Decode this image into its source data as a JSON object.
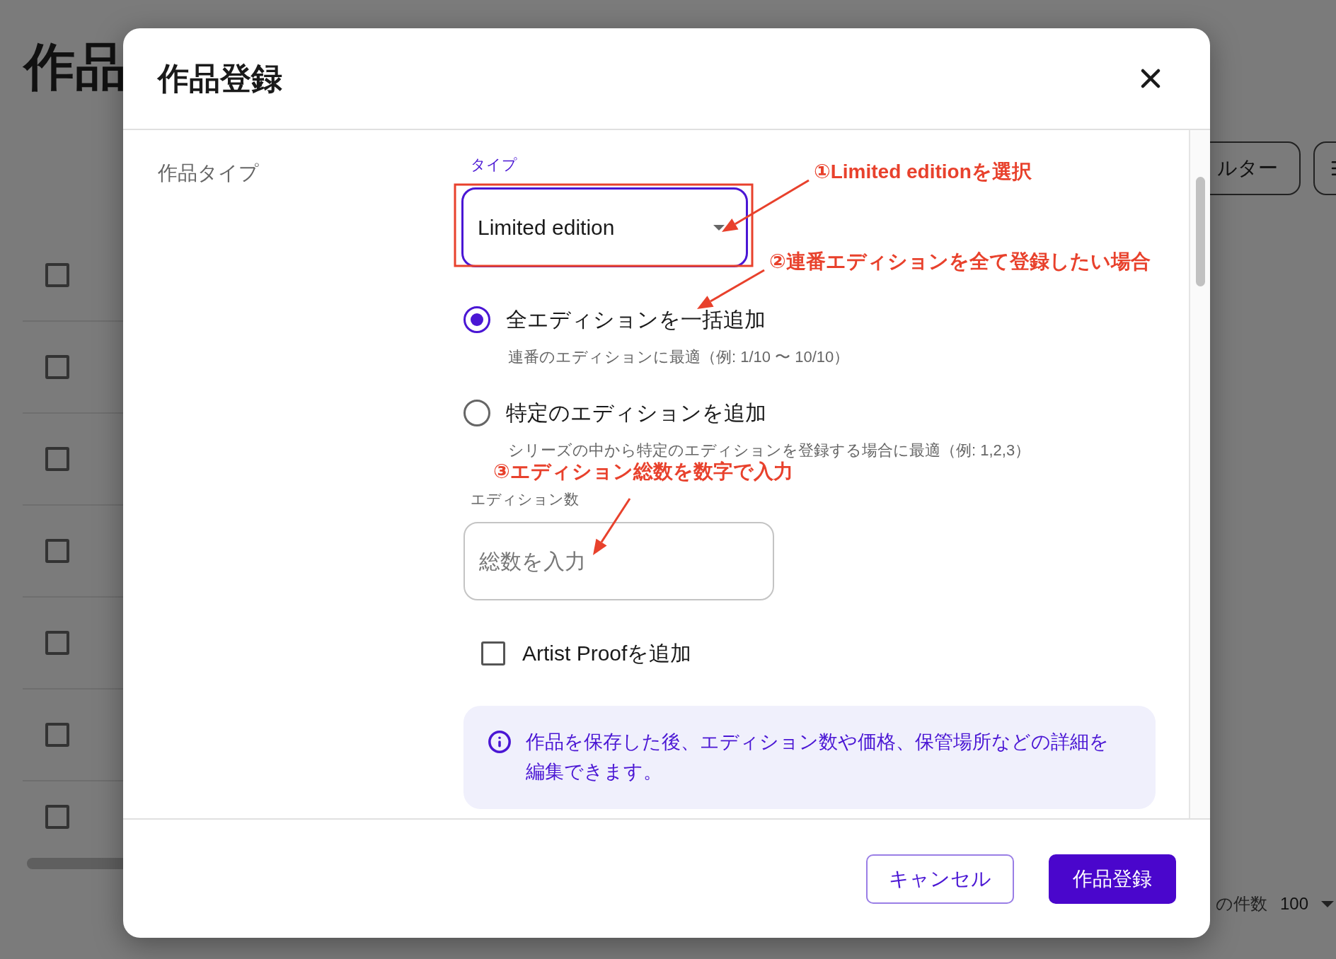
{
  "background_page": {
    "title": "作品",
    "toolbar_buttons": [
      {
        "label": "ルター",
        "kind": "text"
      },
      {
        "kind": "icon"
      }
    ],
    "rows": [
      {
        "checked": false
      },
      {
        "checked": false
      },
      {
        "checked": false
      },
      {
        "checked": false
      },
      {
        "checked": false
      },
      {
        "checked": false
      },
      {
        "checked": false
      }
    ],
    "footer": {
      "label": "の件数",
      "page_size": "100"
    }
  },
  "dialog": {
    "title": "作品登録",
    "section_label": "作品タイプ",
    "type_select": {
      "label": "タイプ",
      "value": "Limited edition"
    },
    "options": [
      {
        "label": "全エディションを一括追加",
        "description": "連番のエディションに最適（例: 1/10 〜 10/10）",
        "selected": true
      },
      {
        "label": "特定のエディションを追加",
        "description": "シリーズの中から特定のエディションを登録する場合に最適（例: 1,2,3）",
        "selected": false
      }
    ],
    "edition_count": {
      "label": "エディション数",
      "placeholder": "総数を入力"
    },
    "artist_proof": {
      "label": "Artist Proofを追加",
      "checked": false
    },
    "info": "作品を保存した後、エディション数や価格、保管場所などの詳細を編集できます。",
    "buttons": [
      {
        "label": "キャンセル",
        "kind": "secondary"
      },
      {
        "label": "作品登録",
        "kind": "primary"
      }
    ]
  },
  "annotations": [
    {
      "text": "①Limited editionを選択"
    },
    {
      "text": "②連番エディションを全て登録したい場合"
    },
    {
      "text": "③エディション総数を数字で入力"
    }
  ]
}
